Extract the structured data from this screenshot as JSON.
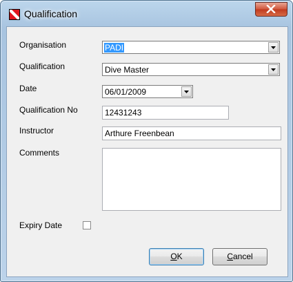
{
  "window": {
    "title": "Qualification",
    "icon": "red-flag-icon"
  },
  "form": {
    "organisation": {
      "label": "Organisation",
      "value": "PADI"
    },
    "qualification": {
      "label": "Qualification",
      "value": "Dive Master"
    },
    "date": {
      "label": "Date",
      "value": "06/01/2009"
    },
    "qualification_no": {
      "label": "Qualification No",
      "value": "12431243"
    },
    "instructor": {
      "label": "Instructor",
      "value": "Arthure Freenbean"
    },
    "comments": {
      "label": "Comments",
      "value": ""
    },
    "expiry_date": {
      "label": "Expiry Date",
      "checked": false
    }
  },
  "buttons": {
    "ok": {
      "accel": "O",
      "rest": "K"
    },
    "cancel": {
      "accel": "C",
      "rest": "ancel"
    }
  },
  "colors": {
    "selection": "#3399ff",
    "close_button": "#c83c22",
    "window_frame": "#a8c4e0"
  }
}
